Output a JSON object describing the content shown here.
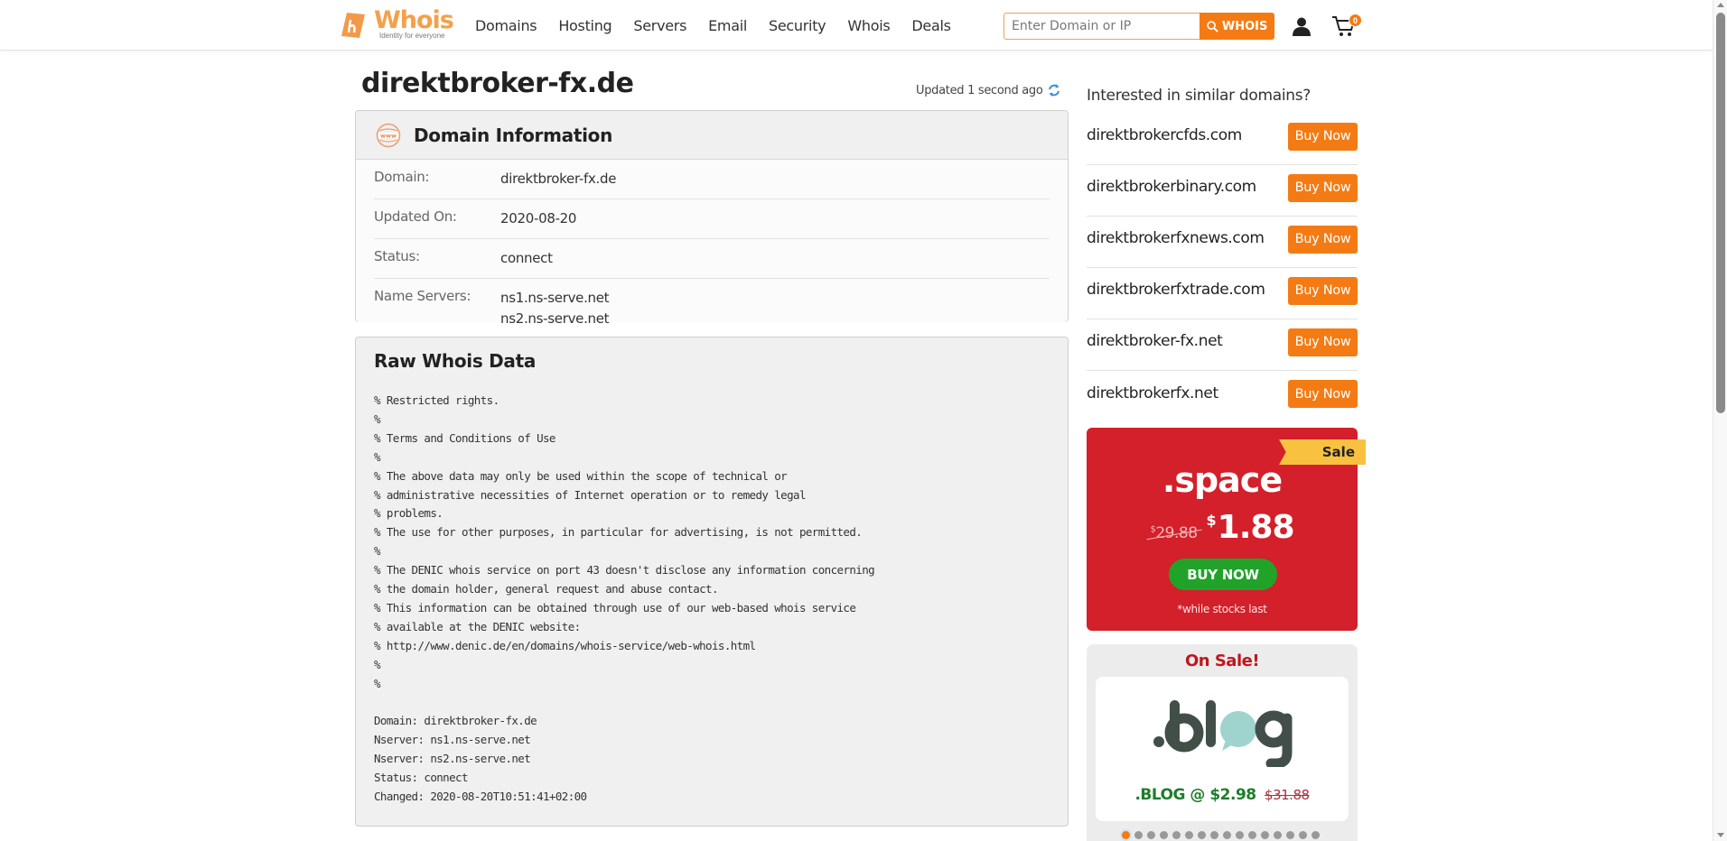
{
  "header": {
    "logo_text": "Whois",
    "logo_tagline": "Identity for everyone",
    "nav": [
      "Domains",
      "Hosting",
      "Servers",
      "Email",
      "Security",
      "Whois",
      "Deals"
    ],
    "search_placeholder": "Enter Domain or IP",
    "search_value": "",
    "search_button": "WHOIS",
    "cart_count": "0",
    "brand_color": "#f47b14"
  },
  "main": {
    "domain_title": "direktbroker-fx.de",
    "updated_text": "Updated 1 second ago",
    "domain_info": {
      "title": "Domain Information",
      "rows": [
        {
          "label": "Domain:",
          "values": [
            "direktbroker-fx.de"
          ]
        },
        {
          "label": "Updated On:",
          "values": [
            "2020-08-20"
          ]
        },
        {
          "label": "Status:",
          "values": [
            "connect"
          ]
        },
        {
          "label": "Name Servers:",
          "values": [
            "ns1.ns-serve.net",
            "ns2.ns-serve.net"
          ]
        }
      ]
    },
    "raw_whois": {
      "title": "Raw Whois Data",
      "text": "% Restricted rights.\n%\n% Terms and Conditions of Use\n%\n% The above data may only be used within the scope of technical or\n% administrative necessities of Internet operation or to remedy legal\n% problems.\n% The use for other purposes, in particular for advertising, is not permitted.\n%\n% The DENIC whois service on port 43 doesn't disclose any information concerning\n% the domain holder, general request and abuse contact.\n% This information can be obtained through use of our web-based whois service\n% available at the DENIC website:\n% http://www.denic.de/en/domains/whois-service/web-whois.html\n%\n%\n\nDomain: direktbroker-fx.de\nNserver: ns1.ns-serve.net\nNserver: ns2.ns-serve.net\nStatus: connect\nChanged: 2020-08-20T10:51:41+02:00"
    }
  },
  "sidebar": {
    "similar_title": "Interested in similar domains?",
    "suggestions": [
      {
        "domain": "direktbrokercfds.com",
        "button": "Buy Now"
      },
      {
        "domain": "direktbrokerbinary.com",
        "button": "Buy Now"
      },
      {
        "domain": "direktbrokerfxnews.com",
        "button": "Buy Now"
      },
      {
        "domain": "direktbrokerfxtrade.com",
        "button": "Buy Now"
      },
      {
        "domain": "direktbroker-fx.net",
        "button": "Buy Now"
      },
      {
        "domain": "direktbrokerfx.net",
        "button": "Buy Now"
      }
    ],
    "promo": {
      "ribbon": "Sale",
      "tld": ".space",
      "old_currency": "$",
      "old_price": "29.88",
      "new_currency": "$",
      "new_price": "1.88",
      "button": "BUY NOW",
      "note": "*while stocks last",
      "bg_color": "#d3202a",
      "button_color": "#21a32a"
    },
    "on_sale": {
      "title": "On Sale!",
      "logo_alt": ".blog",
      "caption": ".BLOG @ $2.98",
      "old_price": "$31.88",
      "slides_total": 16,
      "active_slide": 1
    }
  }
}
